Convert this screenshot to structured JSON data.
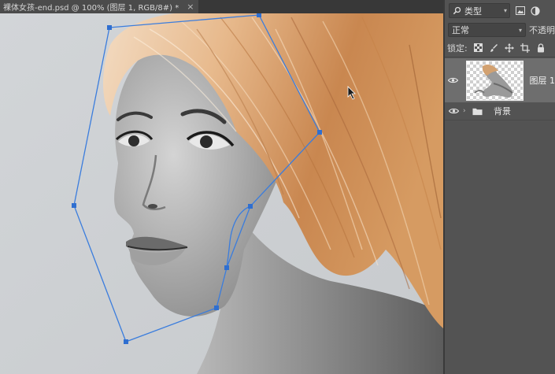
{
  "document": {
    "tab_title": "裸体女孩-end.psd @ 100% (图层 1, RGB/8#) *",
    "close_glyph": "×"
  },
  "layers_panel": {
    "filter": {
      "label": "类型"
    },
    "blend_mode": "正常",
    "opacity_label": "不透明",
    "lock_label": "锁定:",
    "layers": [
      {
        "name": "图层 1",
        "visible": true,
        "selected": true
      },
      {
        "name": "背景",
        "visible": true,
        "selected": false,
        "is_group": true
      }
    ],
    "filter_icons": [
      "image-filter-icon",
      "adjustment-filter-icon"
    ],
    "lock_icons": [
      "lock-transparent-icon",
      "lock-brush-icon",
      "lock-move-icon",
      "lock-artboard-icon",
      "lock-all-icon"
    ]
  },
  "colors": {
    "path_stroke": "#3b7ddd",
    "panel_bg": "#535353",
    "selected_layer_bg": "#6e6e6e"
  }
}
